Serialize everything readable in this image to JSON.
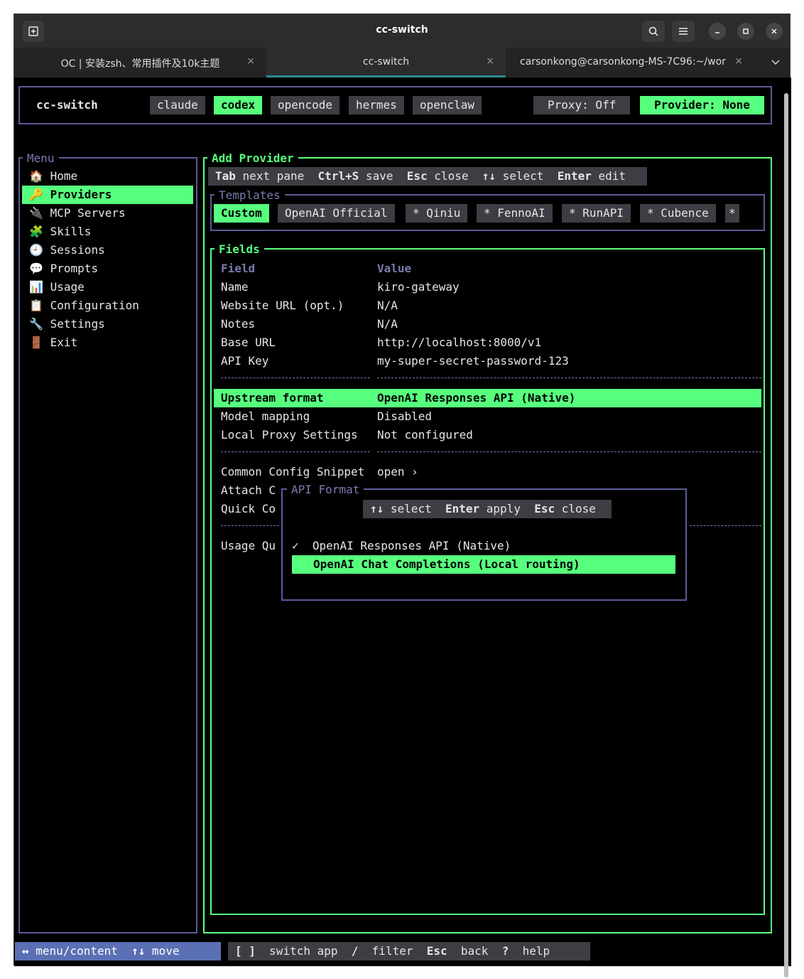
{
  "window": {
    "title": "cc-switch"
  },
  "tabs": [
    {
      "label": "OC | 安装zsh、常用插件及10k主题",
      "close": "×"
    },
    {
      "label": "cc-switch",
      "close": "×"
    },
    {
      "label": "carsonkong@carsonkong-MS-7C96:~/wor…",
      "close": "×"
    }
  ],
  "header": {
    "app_name": "cc-switch",
    "apps": [
      "claude",
      "codex",
      "opencode",
      "hermes",
      "openclaw"
    ],
    "active_app": "codex",
    "proxy": "Proxy: Off",
    "provider": "Provider: None"
  },
  "menu": {
    "title": "Menu",
    "items": [
      {
        "icon": "🏠",
        "label": "Home"
      },
      {
        "icon": "🔑",
        "label": "Providers"
      },
      {
        "icon": "🔌",
        "label": "MCP Servers"
      },
      {
        "icon": "🧩",
        "label": "Skills"
      },
      {
        "icon": "🕘",
        "label": "Sessions"
      },
      {
        "icon": "💬",
        "label": "Prompts"
      },
      {
        "icon": "📊",
        "label": "Usage"
      },
      {
        "icon": "📋",
        "label": "Configuration"
      },
      {
        "icon": "🔧",
        "label": "Settings"
      },
      {
        "icon": "🚪",
        "label": "Exit"
      }
    ]
  },
  "add_provider": {
    "title": "Add Provider",
    "hints": [
      {
        "key": "Tab",
        "desc": "next pane"
      },
      {
        "key": "Ctrl+S",
        "desc": "save"
      },
      {
        "key": "Esc",
        "desc": "close"
      },
      {
        "key": "↑↓",
        "desc": "select"
      },
      {
        "key": "Enter",
        "desc": "edit"
      }
    ],
    "templates_title": "Templates",
    "templates": [
      "Custom",
      "OpenAI Official",
      "* Qiniu",
      "* FennoAI",
      "* RunAPI",
      "* Cubence",
      "*"
    ]
  },
  "fields": {
    "title": "Fields",
    "header_field": "Field",
    "header_value": "Value",
    "rows": [
      {
        "field": "Name",
        "value": "kiro-gateway"
      },
      {
        "field": "Website URL (opt.)",
        "value": "N/A"
      },
      {
        "field": "Notes",
        "value": "N/A"
      },
      {
        "field": "Base URL",
        "value": "http://localhost:8000/v1"
      },
      {
        "field": "API Key",
        "value": "my-super-secret-password-123"
      }
    ],
    "rows2": [
      {
        "field": "Upstream format",
        "value": "OpenAI Responses API (Native)"
      },
      {
        "field": "Model mapping",
        "value": "Disabled"
      },
      {
        "field": "Local Proxy Settings",
        "value": "Not configured"
      }
    ],
    "common_snippet": "Common Config Snippet",
    "common_snippet_value": "open ›",
    "attach_partial": "Attach C",
    "quick_partial": "Quick Co",
    "usage_partial": "Usage Qu"
  },
  "api_format_popup": {
    "title": "API Format",
    "hints": [
      {
        "key": "↑↓",
        "desc": "select"
      },
      {
        "key": "Enter",
        "desc": "apply"
      },
      {
        "key": "Esc",
        "desc": "close"
      }
    ],
    "options": [
      {
        "check": "✓",
        "label": "OpenAI Responses API (Native)"
      },
      {
        "check": "",
        "label": "OpenAI Chat Completions (Local routing)"
      }
    ]
  },
  "footer": {
    "left": [
      {
        "key": "↔",
        "desc": "menu/content"
      },
      {
        "key": "↑↓",
        "desc": "move"
      }
    ],
    "right": [
      {
        "key": "[ ]",
        "desc": "switch app"
      },
      {
        "key": "/",
        "desc": "filter"
      },
      {
        "key": "Esc",
        "desc": "back"
      },
      {
        "key": "?",
        "desc": "help"
      }
    ]
  },
  "colors": {
    "accent": "#57ff7e",
    "border": "#5b5b9a",
    "chip": "#3d3d44",
    "footer_left": "#5a6fb4"
  }
}
